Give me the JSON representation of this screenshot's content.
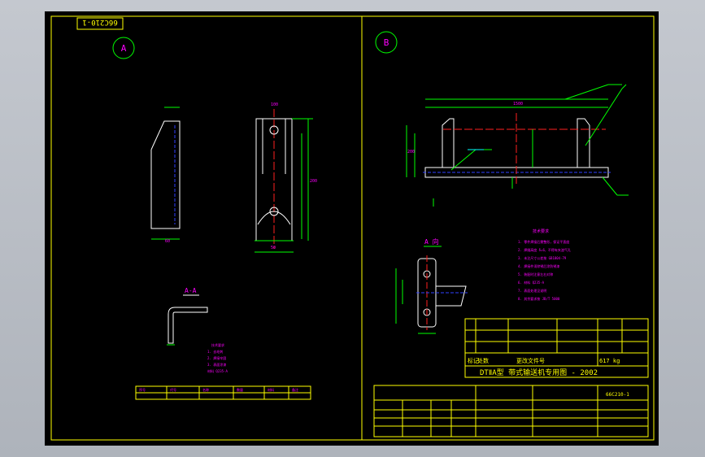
{
  "drawing": {
    "code_rotated": "66C210-1",
    "view_a_label": "A",
    "view_b_label": "B",
    "section_label": "A-A",
    "detail_view_label": "A 向",
    "title_main": "DTⅡA型 带式输送机专用图 - 2002",
    "mass": "617 kg",
    "drawing_no": "66C210-1",
    "notes_text": "技术要求",
    "note_lines": [
      "1. 零件焊接后需整形，保证平直度",
      "2. 焊缝高度 δ=6，不得有夹渣气孔",
      "3. 未注尺寸公差按 GB1804-79",
      "4. 焊接件须除锈后涂防锈漆",
      "5. 装配时注意左右对称",
      "6. 材料 Q235-A",
      "7. 表面处理见说明",
      "8. 其余要求按 JB/T 5000"
    ],
    "left_notes": [
      "技术要求",
      "1. 去毛刺",
      "2. 焊接牢固",
      "3. 表面涂漆",
      "材料 Q235-A"
    ],
    "left_table": [
      "序号",
      "代号",
      "名称",
      "数量",
      "材料",
      "备注"
    ],
    "title_rows": [
      "标记",
      "处数",
      "分区",
      "更改文件号",
      "签名",
      "日期"
    ],
    "dims": {
      "d1": "100",
      "d2": "60",
      "d3": "200",
      "d4": "1500",
      "d5": "50",
      "d6": "30",
      "d7": "20"
    }
  },
  "colors": {
    "border": "#ffff00",
    "outline": "#00ff00",
    "text": "#ff00ff",
    "center": "#ff2020",
    "hidden": "#3040ff"
  }
}
